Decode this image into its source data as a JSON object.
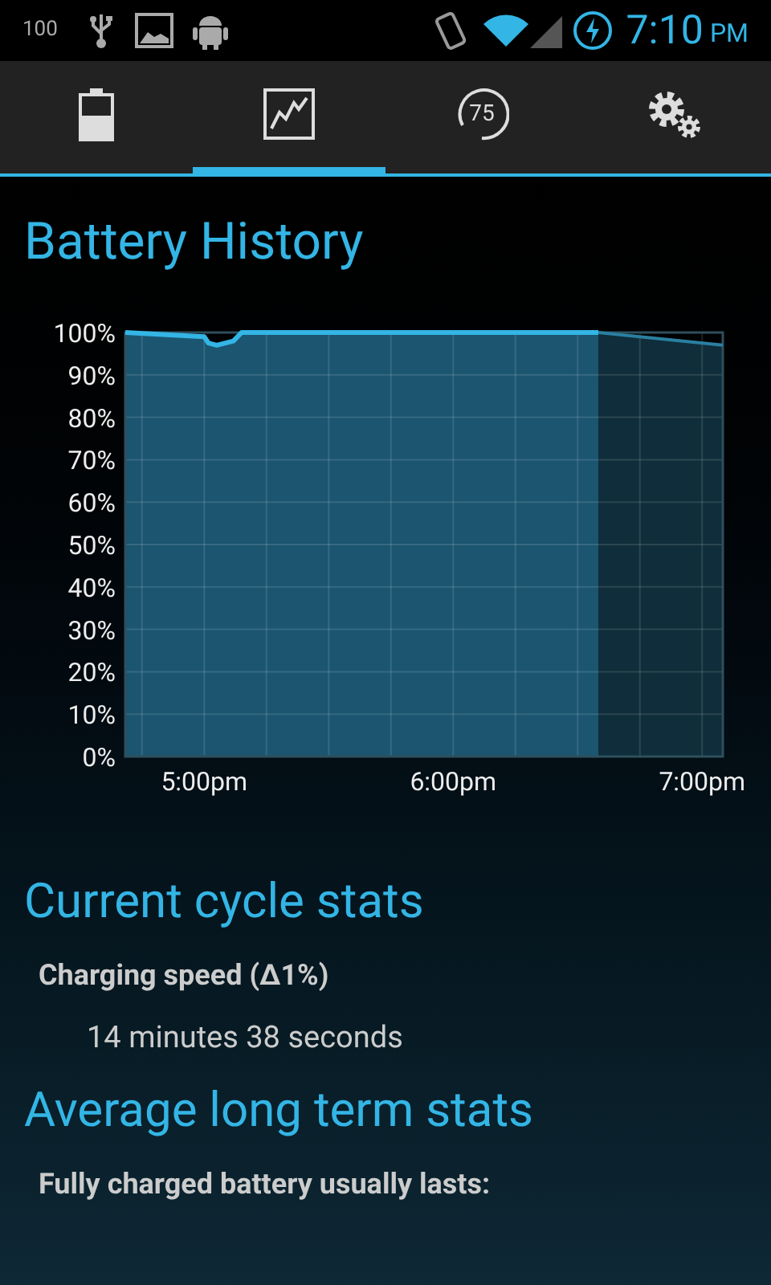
{
  "status_bar": {
    "battery_text": "100",
    "time": "7:10",
    "am_pm": "PM"
  },
  "tabs": [
    {
      "kind": "battery",
      "selected": false
    },
    {
      "kind": "history",
      "selected": true
    },
    {
      "kind": "gauge",
      "label": "75",
      "selected": false
    },
    {
      "kind": "settings",
      "selected": false
    }
  ],
  "page_title": "Battery History",
  "chart": {
    "chart_data": {
      "type": "area",
      "grid": true,
      "x": [
        16.683,
        17,
        17.017,
        17.05,
        17.117,
        17.15,
        18.583,
        19.083
      ],
      "series": [
        {
          "color": "#33b5e5",
          "values": [
            100,
            99,
            97.5,
            97,
            98,
            100,
            100,
            null
          ]
        },
        {
          "color": "#2a7fa0",
          "values": [
            null,
            null,
            null,
            null,
            null,
            null,
            100,
            97
          ]
        }
      ],
      "xlim": [
        16.683,
        19.083
      ],
      "ylim": [
        0,
        100
      ],
      "xticks": [
        {
          "value": 17,
          "label": "5:00pm"
        },
        {
          "value": 18,
          "label": "6:00pm"
        },
        {
          "value": 19,
          "label": "7:00pm"
        }
      ],
      "yticks": [
        {
          "value": 0,
          "label": "0%"
        },
        {
          "value": 10,
          "label": "10%"
        },
        {
          "value": 20,
          "label": "20%"
        },
        {
          "value": 30,
          "label": "30%"
        },
        {
          "value": 40,
          "label": "40%"
        },
        {
          "value": 50,
          "label": "50%"
        },
        {
          "value": 60,
          "label": "60%"
        },
        {
          "value": 70,
          "label": "70%"
        },
        {
          "value": 80,
          "label": "80%"
        },
        {
          "value": 90,
          "label": "90%"
        },
        {
          "value": 100,
          "label": "100%"
        }
      ]
    }
  },
  "sections": [
    {
      "heading": "Current cycle stats",
      "items": [
        {
          "label": "Charging speed (Δ1%)",
          "value": "14 minutes 38 seconds"
        }
      ]
    },
    {
      "heading": "Average long term stats",
      "items": [
        {
          "label": "Fully charged battery usually lasts:"
        }
      ]
    }
  ]
}
